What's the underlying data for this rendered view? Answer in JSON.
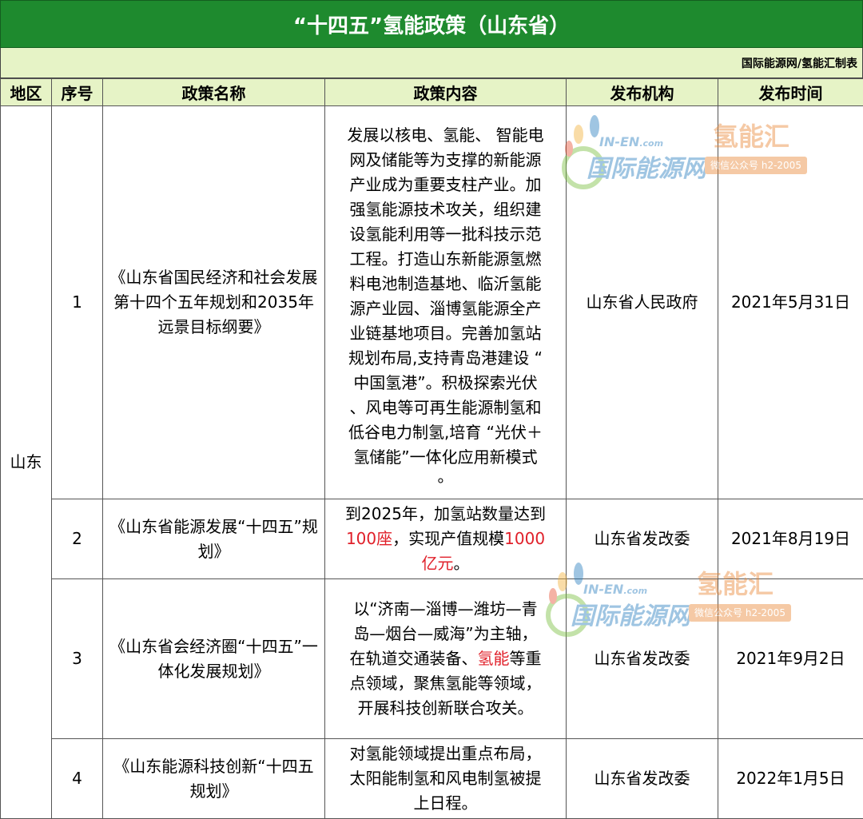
{
  "title": "“十四五”氢能政策（山东省）",
  "source": "国际能源网/氢能汇制表",
  "headers": {
    "region": "地区",
    "no": "序号",
    "name": "政策名称",
    "content": "政策内容",
    "org": "发布机构",
    "date": "发布时间"
  },
  "region": "山东",
  "rows": [
    {
      "no": "1",
      "name": "《山东省国民经济和社会发展第十四个五年规划和2035年远景目标纲要》",
      "content_lines": [
        "发展以核电、氢能、 智能电",
        "网及储能等为支撑的新能源",
        "产业成为重要支柱产业。加",
        "强氢能源技术攻关，组织建",
        "设氢能利用等一批科技示范",
        "工程。打造山东新能源氢燃",
        "料电池制造基地、临沂氢能",
        "源产业园、淄博氢能源全产",
        "业链基地项目。完善加氢站",
        "规划布局,支持青岛港建设 “",
        "中国氢港”。积极探索光伏",
        "、风电等可再生能源制氢和",
        "低谷电力制氢,培育 “光伏＋",
        "氢储能”一体化应用新模式",
        "。"
      ],
      "org": "山东省人民政府",
      "date": "2021年5月31日"
    },
    {
      "no": "2",
      "name": "《山东省能源发展“十四五”规划》",
      "content_l1": "到2025年，加氢站数量达到",
      "content_red1": "100座",
      "content_mid": "，实现产值规模",
      "content_red2": "1000",
      "content_red3": "亿元",
      "content_end": "。",
      "org": "山东省发改委",
      "date": "2021年8月19日"
    },
    {
      "no": "3",
      "name": "《山东省会经济圈“十四五”一体化发展规划》",
      "content_l1": "以“济南—淄博—潍坊—青",
      "content_l2": "岛—烟台—威海”为主轴，",
      "content_l3a": "在轨道交通装备、",
      "content_l3red": "氢能",
      "content_l3b": "等重",
      "content_l4": "点领域，聚焦氢能等领域，",
      "content_l5": "开展科技创新联合攻关。",
      "org": "山东省发改委",
      "date": "2021年9月2日"
    },
    {
      "no": "4",
      "name": "《山东能源科技创新“十四五规划》",
      "content_lines": [
        "对氢能领域提出重点布局，",
        "太阳能制氢和风电制氢被提",
        "上日程。"
      ],
      "org": "山东省发改委",
      "date": "2022年1月5日"
    }
  ],
  "watermark": {
    "logo_en": "IN-EN",
    "logo_en_suffix": ".com",
    "logo_cn": "国际能源网",
    "brand": "氢能汇",
    "wechat": "微信公众号 h2-2005"
  }
}
